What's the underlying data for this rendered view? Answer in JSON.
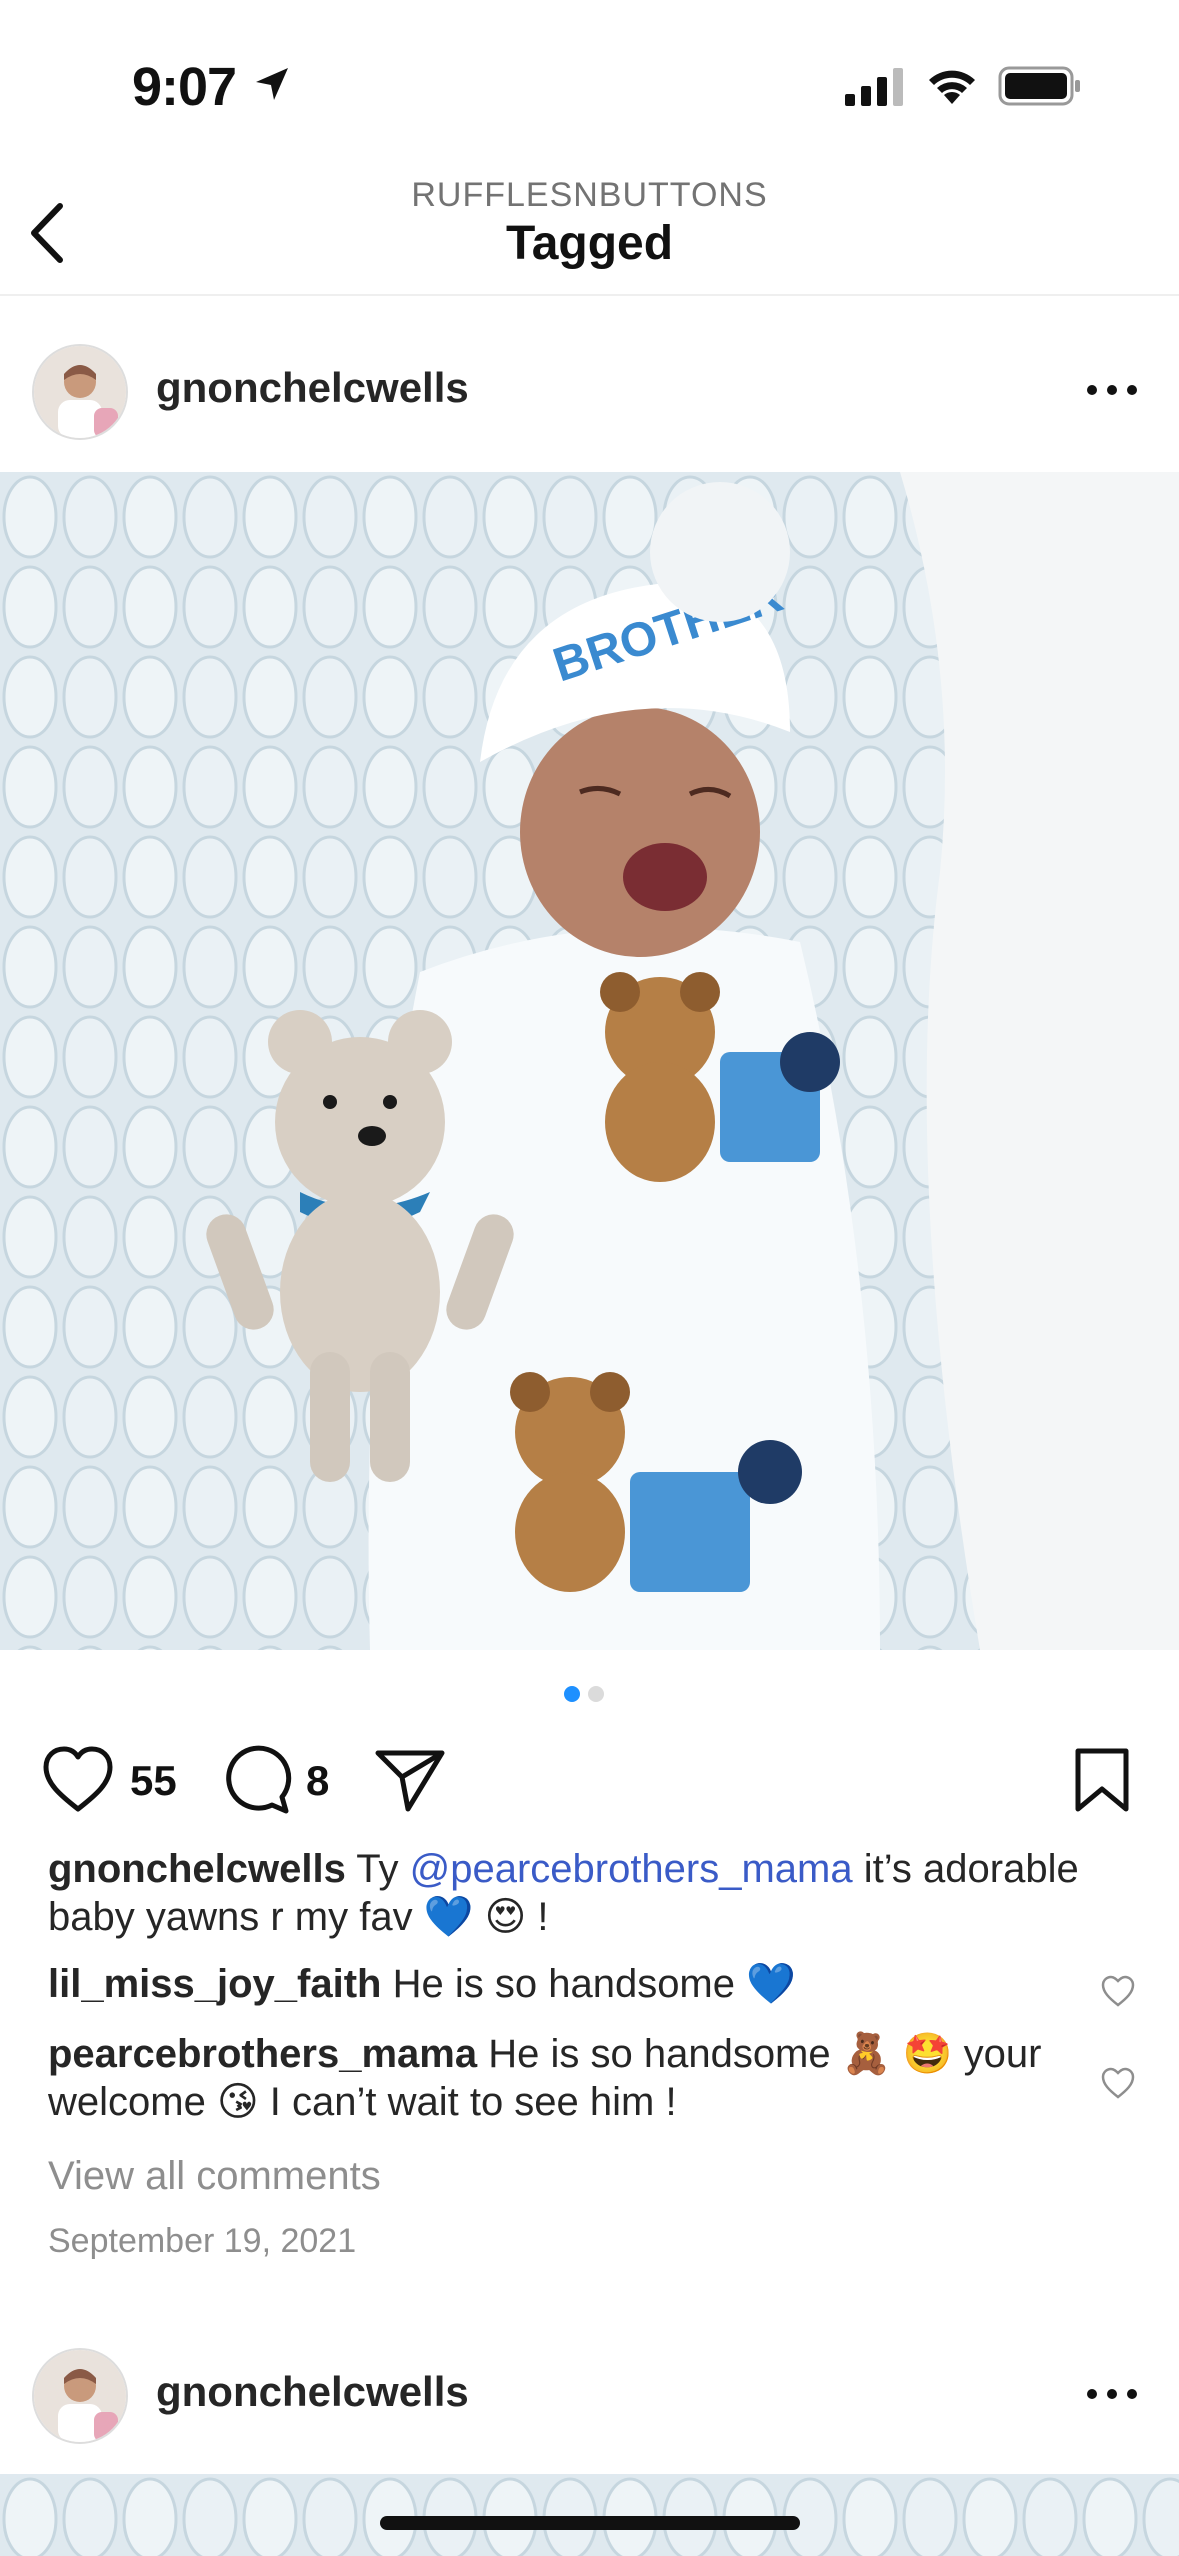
{
  "status_bar": {
    "time": "9:07"
  },
  "nav": {
    "subtitle": "RUFFLESNBUTTONS",
    "title": "Tagged"
  },
  "post": {
    "username": "gnonchelcwells",
    "carousel": {
      "count": 2,
      "active_index": 0,
      "active_color": "#1e90ff",
      "inactive_color": "#dbdbdb"
    },
    "likes": "55",
    "comments_count": "8",
    "caption": {
      "username": "gnonchelcwells",
      "text_before": " Ty ",
      "mention": "@pearcebrothers_mama",
      "text_after": " it’s adorable baby yawns r my fav 💙 😍 !"
    },
    "comments": [
      {
        "username": "lil_miss_joy_faith",
        "text": " He is so handsome 💙"
      },
      {
        "username": "pearcebrothers_mama",
        "text": " He is so handsome 🧸 🤩 your welcome 😘 I can’t wait to see him !"
      }
    ],
    "view_all_label": "View all comments",
    "date": "September 19, 2021"
  },
  "next_post": {
    "username": "gnonchelcwells"
  },
  "icons": {
    "back": "chevron-left-icon",
    "more": "more-horizontal-icon",
    "like": "heart-icon",
    "comment": "comment-bubble-icon",
    "share": "paper-plane-icon",
    "save": "bookmark-icon"
  },
  "colors": {
    "mention": "#3a5bc7",
    "secondary_text": "#8e8e8e"
  }
}
